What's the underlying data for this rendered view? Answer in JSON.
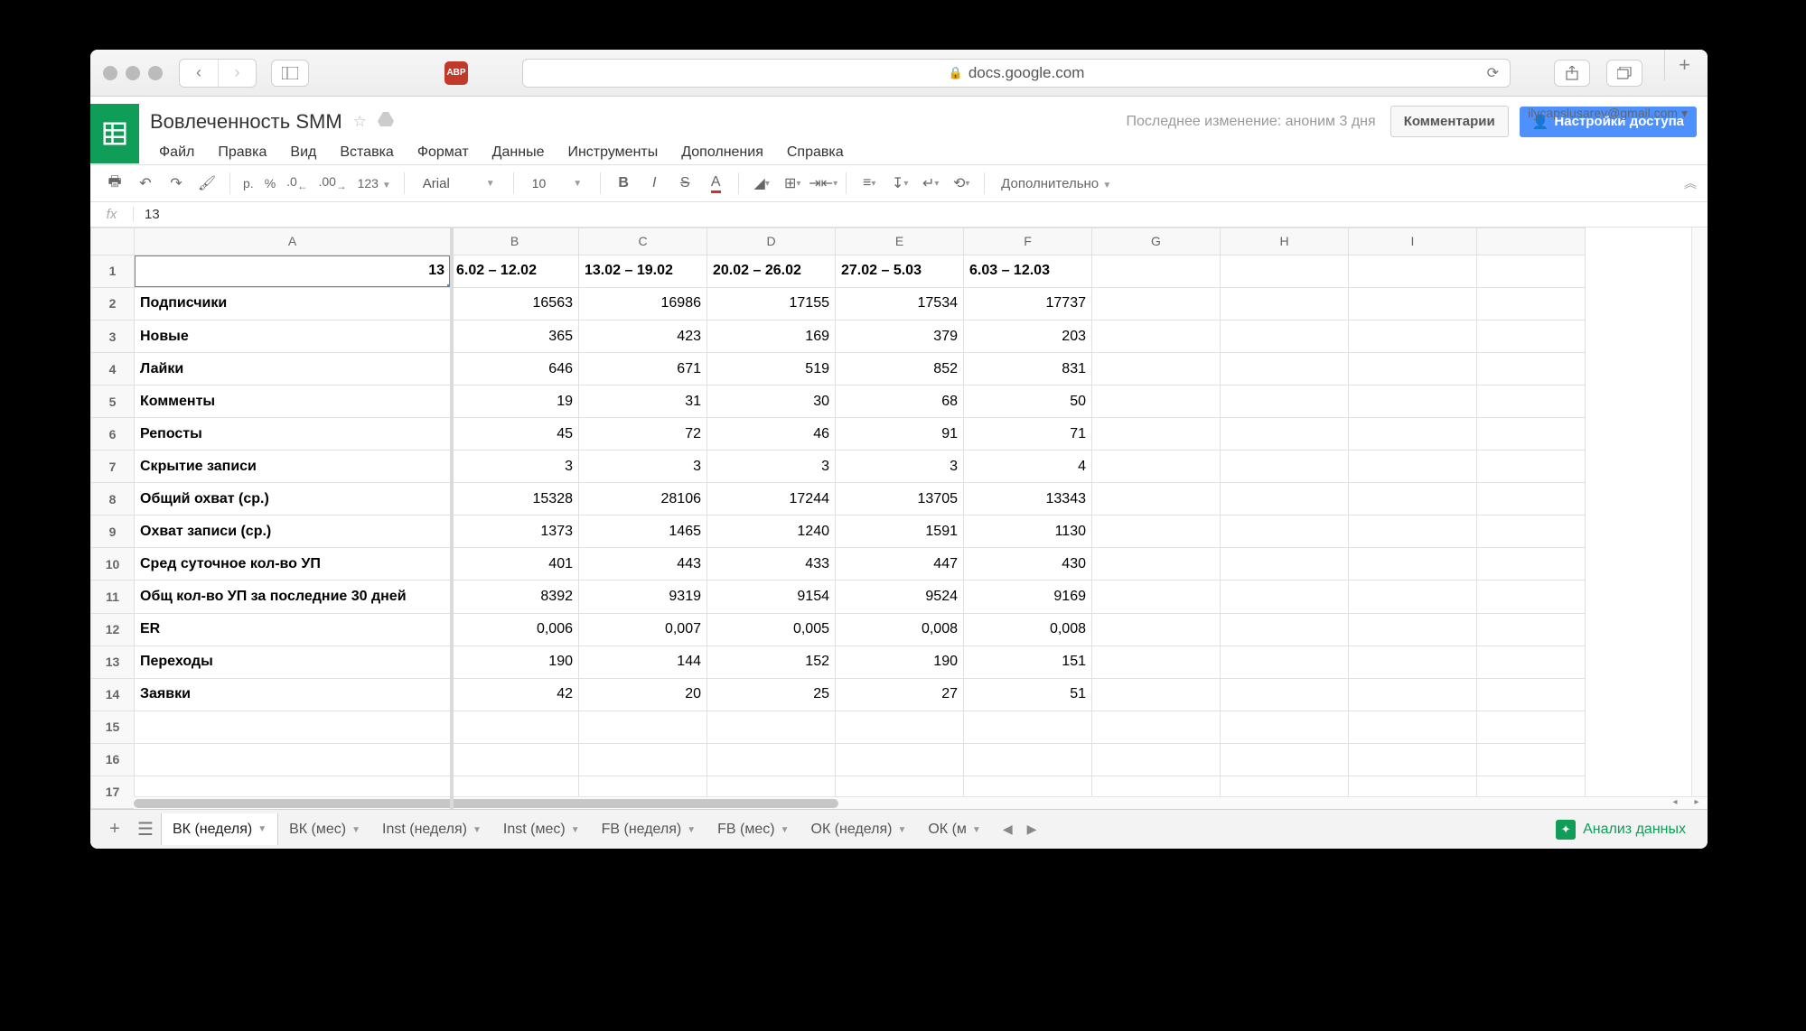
{
  "browser": {
    "url_host": "docs.google.com"
  },
  "doc": {
    "title": "Вовлеченность SMM",
    "user_email": "ilycapslusarev@gmail.com",
    "last_change": "Последнее изменение: аноним 3 дня",
    "comments_btn": "Комментарии",
    "share_btn": "Настройки доступа"
  },
  "menus": [
    "Файл",
    "Правка",
    "Вид",
    "Вставка",
    "Формат",
    "Данные",
    "Инструменты",
    "Дополнения",
    "Справка"
  ],
  "toolbar": {
    "currency": "р.",
    "percent": "%",
    "dec_dec": ".0",
    "inc_dec": ".00",
    "numfmt": "123",
    "font": "Arial",
    "font_size": "10",
    "more": "Дополнительно"
  },
  "fx": {
    "value": "13",
    "cell_value": "13"
  },
  "columns": [
    "A",
    "B",
    "C",
    "D",
    "E",
    "F",
    "G",
    "H",
    "I"
  ],
  "dates": [
    "6.02 – 12.02",
    "13.02 – 19.02",
    "20.02 – 26.02",
    "27.02 – 5.03",
    "6.03 – 12.03"
  ],
  "rows": [
    {
      "label": "Подписчики",
      "vals": [
        "16563",
        "16986",
        "17155",
        "17534",
        "17737"
      ]
    },
    {
      "label": "Новые",
      "vals": [
        "365",
        "423",
        "169",
        "379",
        "203"
      ]
    },
    {
      "label": "Лайки",
      "vals": [
        "646",
        "671",
        "519",
        "852",
        "831"
      ]
    },
    {
      "label": "Комменты",
      "vals": [
        "19",
        "31",
        "30",
        "68",
        "50"
      ]
    },
    {
      "label": "Репосты",
      "vals": [
        "45",
        "72",
        "46",
        "91",
        "71"
      ]
    },
    {
      "label": "Скрытие записи",
      "vals": [
        "3",
        "3",
        "3",
        "3",
        "4"
      ]
    },
    {
      "label": "Общий охват (ср.)",
      "vals": [
        "15328",
        "28106",
        "17244",
        "13705",
        "13343"
      ]
    },
    {
      "label": "Охват записи (ср.)",
      "vals": [
        "1373",
        "1465",
        "1240",
        "1591",
        "1130"
      ]
    },
    {
      "label": "Сред суточное кол-во УП",
      "vals": [
        "401",
        "443",
        "433",
        "447",
        "430"
      ]
    },
    {
      "label": "Общ кол-во УП за последние 30 дней",
      "vals": [
        "8392",
        "9319",
        "9154",
        "9524",
        "9169"
      ]
    },
    {
      "label": "ER",
      "vals": [
        "0,006",
        "0,007",
        "0,005",
        "0,008",
        "0,008"
      ]
    },
    {
      "label": "Переходы",
      "vals": [
        "190",
        "144",
        "152",
        "190",
        "151"
      ]
    },
    {
      "label": "Заявки",
      "vals": [
        "42",
        "20",
        "25",
        "27",
        "51"
      ]
    }
  ],
  "sheet_tabs": [
    "ВК (неделя)",
    "ВК  (мес)",
    "Inst (неделя)",
    "Inst (мес)",
    "FB (неделя)",
    "FB (мес)",
    "ОК (неделя)",
    "ОК (м"
  ],
  "active_tab": 0,
  "explore": "Анализ данных"
}
